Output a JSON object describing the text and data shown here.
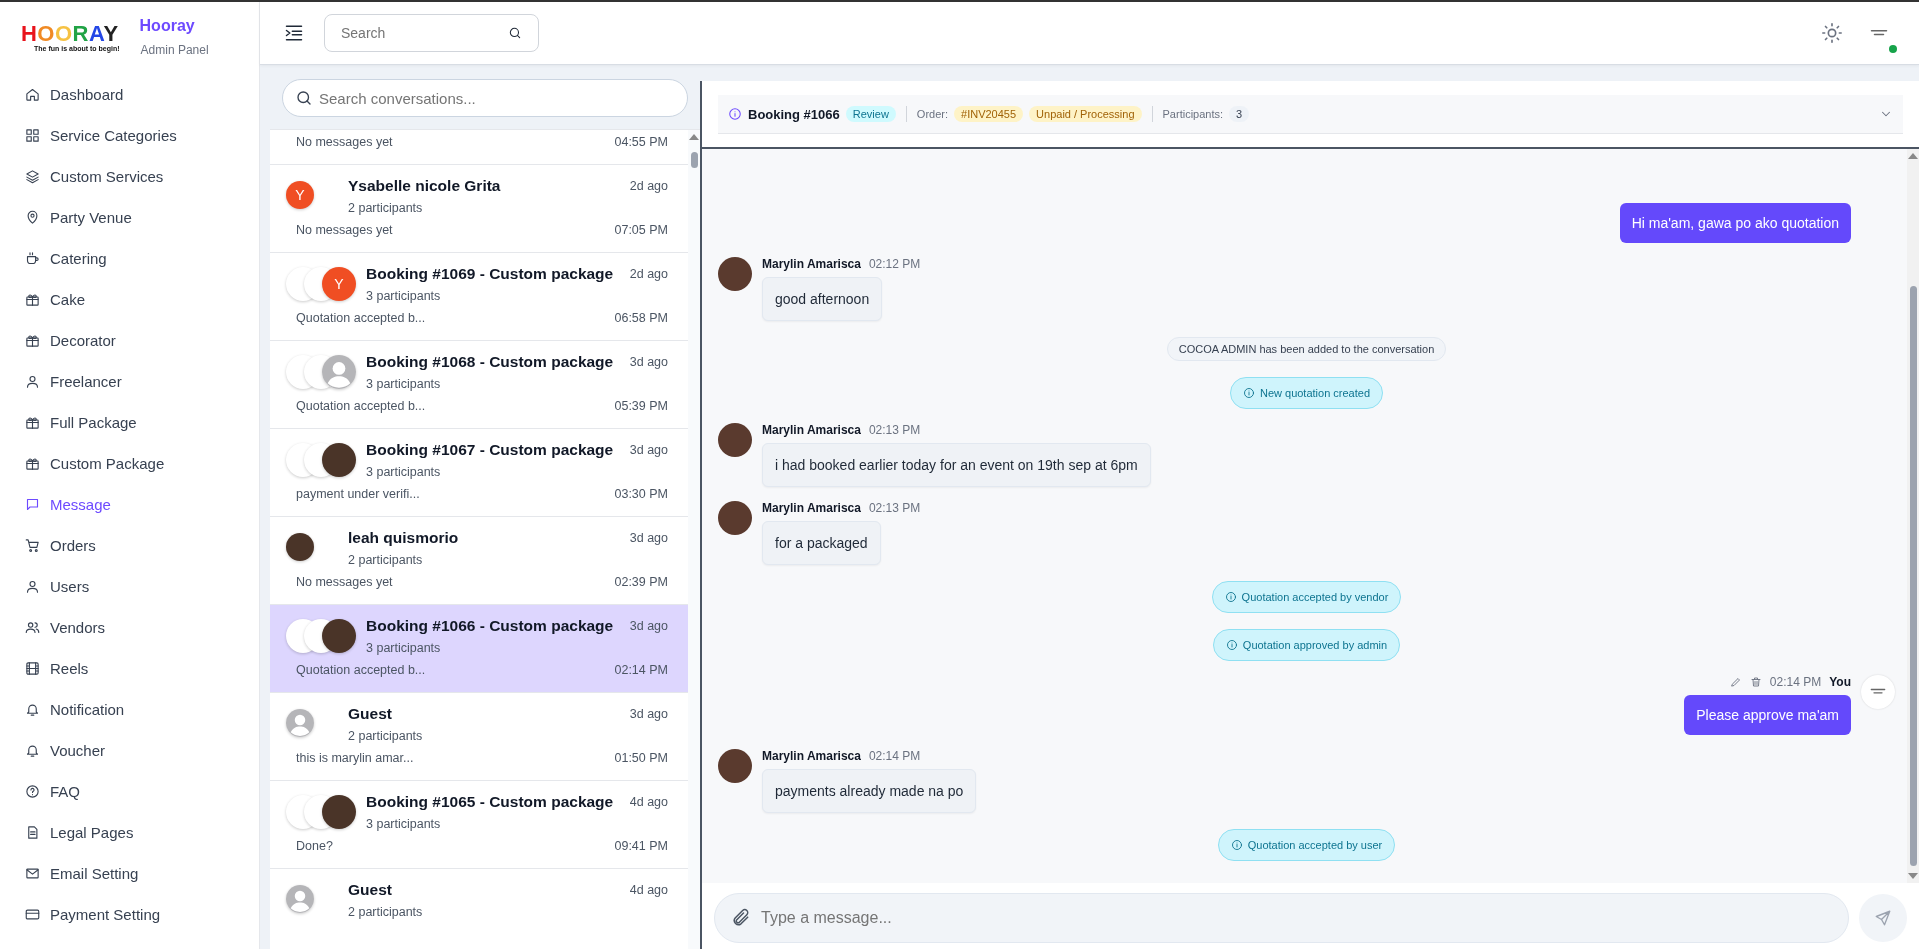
{
  "sidebar": {
    "logo": {
      "wordmark": "HOORAY",
      "tagline": "The fun is about to begin!"
    },
    "title": "Hooray",
    "subtitle": "Admin Panel",
    "items": [
      {
        "label": "Dashboard",
        "selected": false
      },
      {
        "label": "Service Categories",
        "selected": false
      },
      {
        "label": "Custom Services",
        "selected": false
      },
      {
        "label": "Party Venue",
        "selected": false
      },
      {
        "label": "Catering",
        "selected": false
      },
      {
        "label": "Cake",
        "selected": false
      },
      {
        "label": "Decorator",
        "selected": false
      },
      {
        "label": "Freelancer",
        "selected": false
      },
      {
        "label": "Full Package",
        "selected": false
      },
      {
        "label": "Custom Package",
        "selected": false
      },
      {
        "label": "Message",
        "selected": true
      },
      {
        "label": "Orders",
        "selected": false
      },
      {
        "label": "Users",
        "selected": false
      },
      {
        "label": "Vendors",
        "selected": false
      },
      {
        "label": "Reels",
        "selected": false
      },
      {
        "label": "Notification",
        "selected": false
      },
      {
        "label": "Voucher",
        "selected": false
      },
      {
        "label": "FAQ",
        "selected": false
      },
      {
        "label": "Legal Pages",
        "selected": false
      },
      {
        "label": "Email Setting",
        "selected": false
      },
      {
        "label": "Payment Setting",
        "selected": false
      }
    ]
  },
  "topbar": {
    "search": {
      "placeholder": "Search"
    }
  },
  "conversations": {
    "search": {
      "placeholder": "Search conversations..."
    },
    "items": [
      {
        "preview": "No messages yet",
        "time": "04:55 PM",
        "selected": false
      },
      {
        "name": "Ysabelle nicole Grita",
        "participants": "2 participants",
        "ago": "2d ago",
        "preview": "No messages yet",
        "time": "07:05 PM",
        "selected": false,
        "avatar": {
          "kind": "letter",
          "letter": "Y"
        }
      },
      {
        "name": "Booking #1069 - Custom package",
        "participants": "3 participants",
        "ago": "2d ago",
        "preview": "Quotation accepted b...",
        "time": "06:58 PM",
        "selected": false,
        "avatar": {
          "kind": "group",
          "member": {
            "kind": "letter",
            "letter": "Y"
          }
        }
      },
      {
        "name": "Booking #1068 - Custom package",
        "participants": "3 participants",
        "ago": "3d ago",
        "preview": "Quotation accepted b...",
        "time": "05:39 PM",
        "selected": false,
        "avatar": {
          "kind": "group",
          "member": {
            "kind": "guest"
          }
        }
      },
      {
        "name": "Booking #1067 - Custom package",
        "participants": "3 participants",
        "ago": "3d ago",
        "preview": "payment under verifi...",
        "time": "03:30 PM",
        "selected": false,
        "avatar": {
          "kind": "group",
          "member": {
            "kind": "photo"
          }
        }
      },
      {
        "name": "leah quismorio",
        "participants": "2 participants",
        "ago": "3d ago",
        "preview": "No messages yet",
        "time": "02:39 PM",
        "selected": false,
        "avatar": {
          "kind": "photo"
        }
      },
      {
        "name": "Booking #1066 - Custom package",
        "participants": "3 participants",
        "ago": "3d ago",
        "preview": "Quotation accepted b...",
        "time": "02:14 PM",
        "selected": true,
        "avatar": {
          "kind": "group",
          "member": {
            "kind": "photo"
          }
        }
      },
      {
        "name": "Guest",
        "participants": "2 participants",
        "ago": "3d ago",
        "preview": "this is marylin amar...",
        "time": "01:50 PM",
        "selected": false,
        "avatar": {
          "kind": "guest"
        }
      },
      {
        "name": "Booking #1065 - Custom package",
        "participants": "3 participants",
        "ago": "4d ago",
        "preview": "Done?",
        "time": "09:41 PM",
        "selected": false,
        "avatar": {
          "kind": "group",
          "member": {
            "kind": "photo"
          }
        }
      },
      {
        "name": "Guest",
        "participants": "2 participants",
        "ago": "4d ago",
        "selected": false,
        "avatar": {
          "kind": "guest"
        }
      }
    ]
  },
  "chat": {
    "header": {
      "title": "Booking #1066",
      "status": "Review",
      "order_label": "Order:",
      "order": "#INV20455",
      "payment": "Unpaid / Processing",
      "participants_label": "Participants:",
      "participants": "3"
    },
    "messages": [
      {
        "kind": "outgoing",
        "text": "Hi ma'am, gawa po ako quotation"
      },
      {
        "kind": "incoming",
        "sender": "Marylin Amarisca",
        "time": "02:12 PM",
        "text": "good afternoon"
      },
      {
        "kind": "system",
        "text": "COCOA ADMIN has been added to the conversation"
      },
      {
        "kind": "event",
        "text": "New quotation created"
      },
      {
        "kind": "incoming",
        "sender": "Marylin Amarisca",
        "time": "02:13 PM",
        "text": "i had booked earlier today for an event on 19th sep at 6pm"
      },
      {
        "kind": "incoming",
        "sender": "Marylin Amarisca",
        "time": "02:13 PM",
        "text": "for a packaged"
      },
      {
        "kind": "event",
        "text": "Quotation accepted by vendor"
      },
      {
        "kind": "event",
        "text": "Quotation approved by admin"
      },
      {
        "kind": "outgoing",
        "sender": "You",
        "time": "02:14 PM",
        "text": "Please approve ma'am"
      },
      {
        "kind": "incoming",
        "sender": "Marylin Amarisca",
        "time": "02:14 PM",
        "text": "payments already made na po"
      },
      {
        "kind": "event",
        "text": "Quotation accepted by user"
      }
    ],
    "composer": {
      "placeholder": "Type a message..."
    }
  }
}
